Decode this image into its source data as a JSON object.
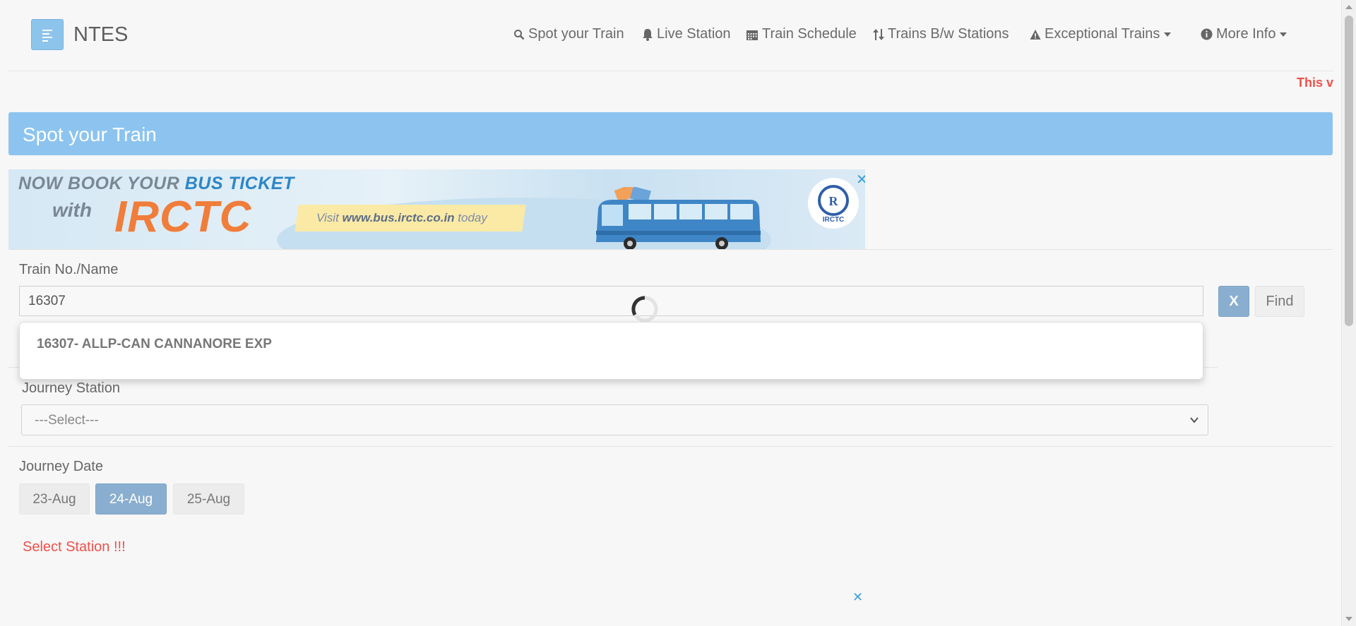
{
  "brand": "NTES",
  "nav": [
    {
      "label": "Spot your Train",
      "icon": "search-icon"
    },
    {
      "label": "Live Station",
      "icon": "bell-icon"
    },
    {
      "label": "Train Schedule",
      "icon": "calendar-icon"
    },
    {
      "label": "Trains B/w Stations",
      "icon": "updown-arrows-icon"
    },
    {
      "label": "Exceptional Trains",
      "icon": "warning-icon"
    },
    {
      "label": "More Info",
      "icon": "info-icon"
    }
  ],
  "ticker_text": "This v",
  "page_title": "Spot your Train",
  "banner": {
    "line1_a": "NOW BOOK YOUR ",
    "line1_b": "BUS TICKET",
    "line2": "with",
    "line3": "IRCTC",
    "visit_a": "Visit ",
    "visit_b": "www.bus.irctc.co.in",
    "visit_c": " today",
    "logo_text": "IRCTC",
    "close": "✕"
  },
  "train_field": {
    "label": "Train No./Name",
    "value": "16307",
    "clear_label": "X",
    "find_label": "Find"
  },
  "suggestions": [
    "16307- ALLP-CAN CANNANORE EXP"
  ],
  "journey_station": {
    "label": "Journey Station",
    "selected": "---Select---"
  },
  "journey_date": {
    "label": "Journey Date",
    "dates": [
      "23-Aug",
      "24-Aug",
      "25-Aug"
    ],
    "selected": "24-Aug"
  },
  "warning": "Select Station !!!",
  "bottom_close": "✕",
  "colors": {
    "header": "#8cc4ef",
    "accent_button": "#8aaecf",
    "warning": "#f0504a"
  }
}
